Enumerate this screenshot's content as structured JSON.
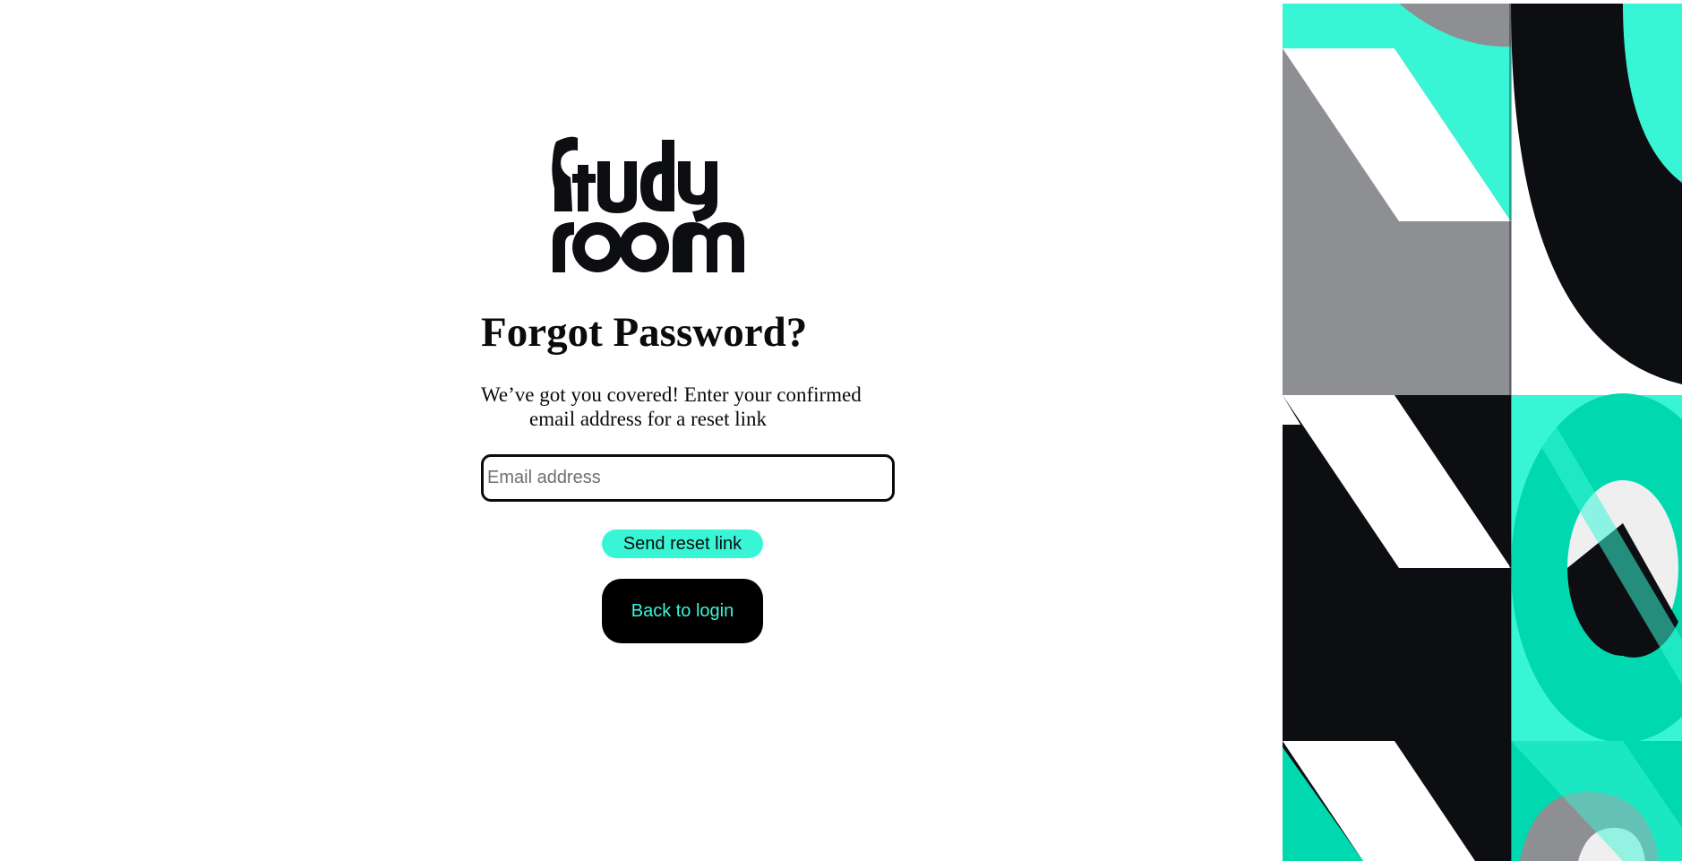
{
  "brand": {
    "logo_line1": "Study",
    "logo_line2": "room",
    "logo_color": "#0d0e11"
  },
  "form": {
    "title": "Forgot Password?",
    "subtitle_line1": "We’ve got you covered! Enter your confirmed",
    "subtitle_line2": "email address for a reset link",
    "email_placeholder": "Email address",
    "email_value": "",
    "send_label": "Send reset link",
    "back_label": "Back to login"
  },
  "colors": {
    "accent": "#38f5d6",
    "accent_dark": "#00d9b0",
    "ink": "#0d0e11",
    "gray": "#8e8f93",
    "background": "#ffffff"
  },
  "decoration": {
    "name": "geometric-pattern"
  }
}
